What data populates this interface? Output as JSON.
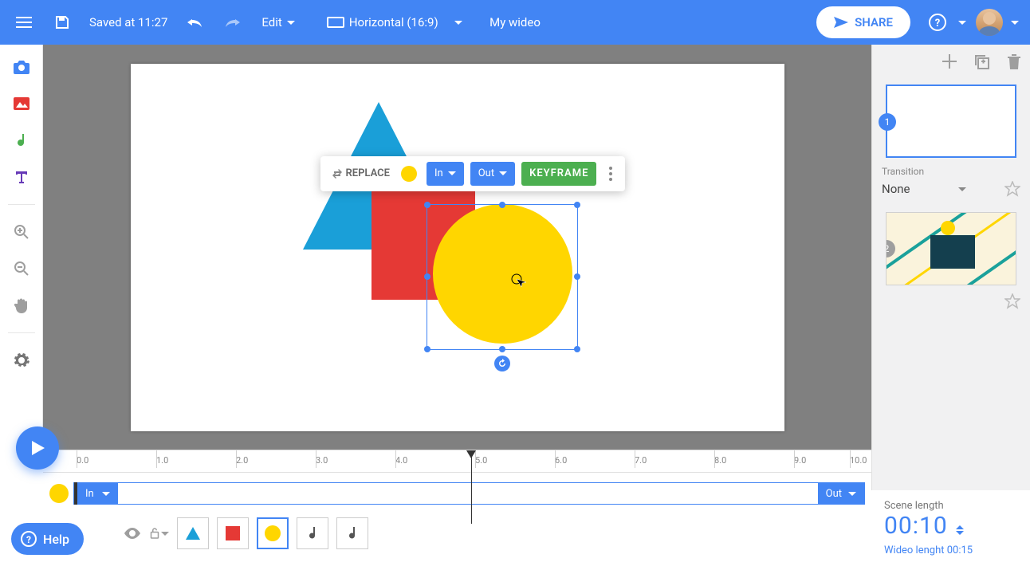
{
  "header": {
    "saved_label": "Saved at 11:27",
    "edit_label": "Edit",
    "orient_label": "Horizontal (16:9)",
    "doc_title": "My wideo",
    "share_label": "SHARE"
  },
  "floatbar": {
    "replace_label": "REPLACE",
    "in_label": "In",
    "out_label": "Out",
    "keyframe_label": "KEYFRAME"
  },
  "rightpanel": {
    "transition_label": "Transition",
    "transition_value": "None",
    "scenes": [
      {
        "num": "1"
      },
      {
        "num": "2"
      }
    ]
  },
  "timeline": {
    "ticks": [
      "0.0",
      "1.0",
      "2.0",
      "3.0",
      "4.0",
      "5.0",
      "6.0",
      "7.0",
      "8.0",
      "9.0",
      "10.0"
    ],
    "in_label": "In",
    "out_label": "Out"
  },
  "sceneinfo": {
    "length_label": "Scene length",
    "length_value": "00:10",
    "wideo_label": "Wideo lenght ",
    "wideo_value": "00:15"
  },
  "help_label": "Help"
}
